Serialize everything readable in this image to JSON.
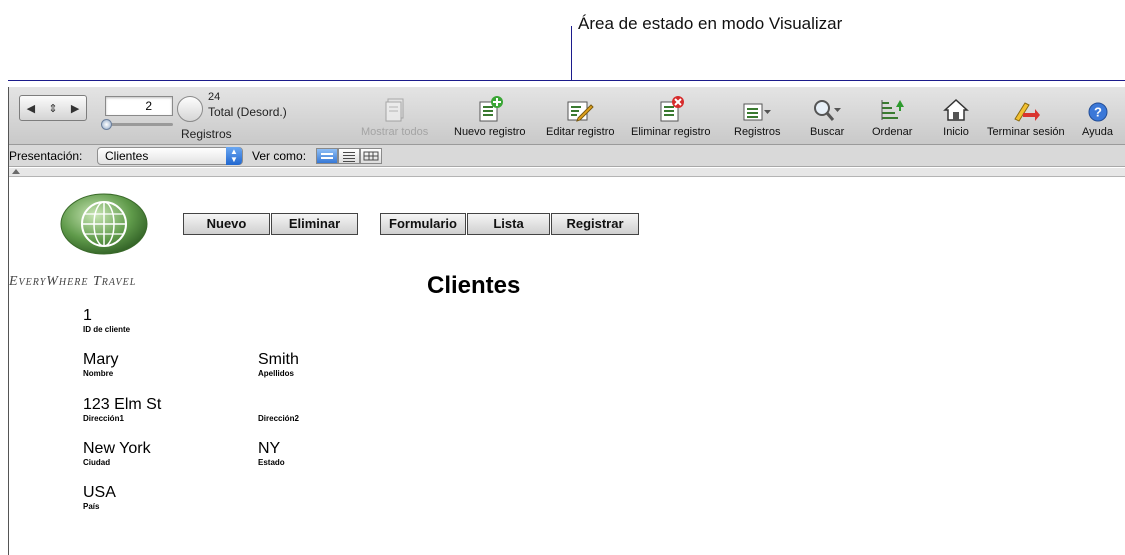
{
  "callout": {
    "text": "Área de estado en modo Visualizar"
  },
  "toolbar": {
    "current_record": "2",
    "found_count": "24",
    "total_label": "Total (Desord.)",
    "records_label": "Registros",
    "tools": [
      {
        "label": "Mostrar todos",
        "icon": "show-all-icon",
        "enabled": false
      },
      {
        "label": "Nuevo registro",
        "icon": "new-record-icon",
        "enabled": true
      },
      {
        "label": "Editar registro",
        "icon": "edit-record-icon",
        "enabled": true
      },
      {
        "label": "Eliminar registro",
        "icon": "delete-record-icon",
        "enabled": true
      },
      {
        "label": "Registros",
        "icon": "records-menu-icon",
        "enabled": true
      },
      {
        "label": "Buscar",
        "icon": "search-icon",
        "enabled": true
      },
      {
        "label": "Ordenar",
        "icon": "sort-icon",
        "enabled": true
      },
      {
        "label": "Inicio",
        "icon": "home-icon",
        "enabled": true
      },
      {
        "label": "Terminar sesión",
        "icon": "logout-icon",
        "enabled": true
      },
      {
        "label": "Ayuda",
        "icon": "help-icon",
        "enabled": true
      }
    ]
  },
  "layout_bar": {
    "presentation_label": "Presentación:",
    "presentation_value": "Clientes",
    "view_as_label": "Ver como:",
    "view_modes": [
      "form",
      "list",
      "table"
    ],
    "active_view": "form"
  },
  "content": {
    "logo_text": "EveryWhere Travel",
    "buttons": {
      "new": "Nuevo",
      "delete": "Eliminar",
      "form": "Formulario",
      "list": "Lista",
      "register": "Registrar"
    },
    "title": "Clientes",
    "fields": {
      "customer_id": {
        "value": "1",
        "label": "ID de cliente"
      },
      "first_name": {
        "value": "Mary",
        "label": "Nombre"
      },
      "last_name": {
        "value": "Smith",
        "label": "Apellidos"
      },
      "address1": {
        "value": "123 Elm St",
        "label": "Dirección1"
      },
      "address2": {
        "value": "",
        "label": "Dirección2"
      },
      "city": {
        "value": "New York",
        "label": "Ciudad"
      },
      "state": {
        "value": "NY",
        "label": "Estado"
      },
      "country": {
        "value": "USA",
        "label": "País"
      }
    }
  },
  "colors": {
    "accent": "#1c1c8c",
    "view_active": "#3779d6",
    "logo_green": "#5f9a4a"
  }
}
